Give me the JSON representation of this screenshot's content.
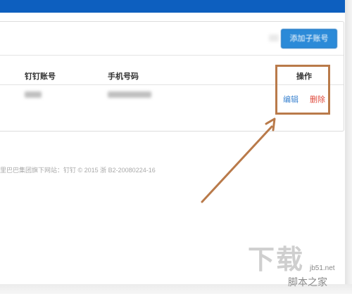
{
  "toolbar": {
    "add_button_label": "添加子账号"
  },
  "table": {
    "columns": [
      "钉钉账号",
      "手机号码",
      "操作"
    ],
    "rows": [
      {
        "dingtalk_account": "",
        "phone": "",
        "actions": {
          "edit": "编辑",
          "delete": "删除"
        }
      }
    ]
  },
  "footer": {
    "text": "里巴巴集团旗下网站：钉钉 © 2015 浙 B2-20080224-16"
  },
  "watermark": {
    "big": "下载",
    "url": "jb51.net",
    "name": "脚本之家"
  },
  "colors": {
    "header_blue": "#0d5fbf",
    "button_blue": "#2b8ad8",
    "edit_link": "#3f86d1",
    "delete_link": "#e04a3c",
    "annotation_brown": "#b97a4a"
  }
}
